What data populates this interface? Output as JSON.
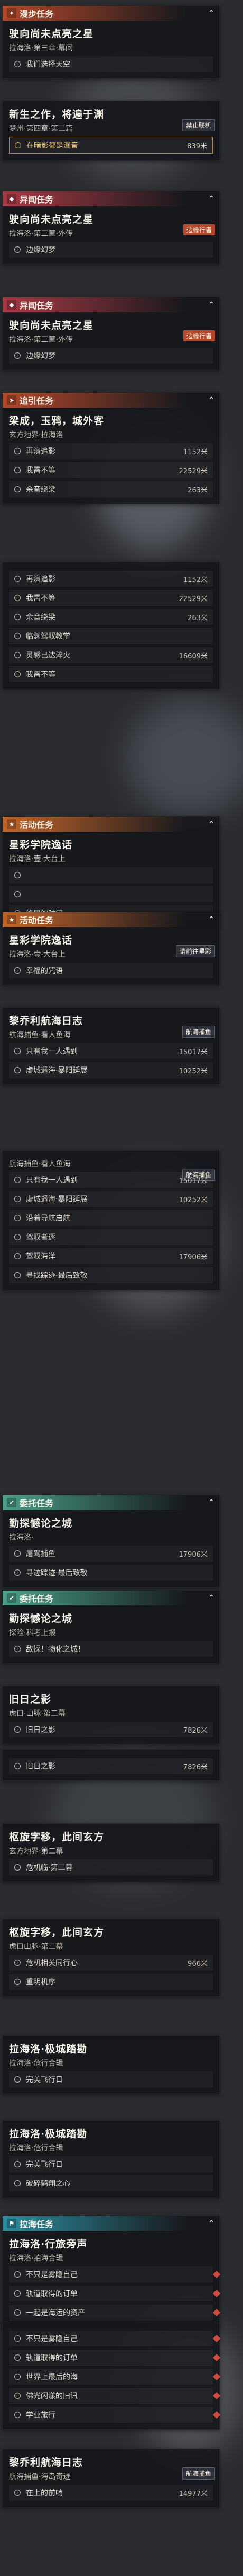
{
  "colors": {
    "story": "#b4482a",
    "anomaly": "#a83a44",
    "event": "#c4662a",
    "errand": "#4aa08a",
    "world": "#2c8fa0"
  },
  "cards": [
    {
      "cat": "漫步任务",
      "title": "驶向尚未点亮之星",
      "sub": "拉海洛·第三章·幕间",
      "rows": [
        {
          "t": "我们选择天空",
          "d": ""
        }
      ],
      "badge": "",
      "icon": "play-icon"
    },
    {
      "cat": "",
      "title": "新生之作，将遍于渊",
      "sub": "梦州·第四章·第二篇",
      "rows": [
        {
          "t": "在暗影都是漏音",
          "d": "839米",
          "gold": true
        }
      ],
      "badge": "禁止联机",
      "icon": ""
    },
    {
      "cat": "异闻任务",
      "title": "驶向尚未点亮之星",
      "sub": "拉海洛·第三章·外传",
      "rows": [
        {
          "t": "边缘幻梦",
          "d": ""
        }
      ],
      "badge": "边缘行者",
      "icon": "diamond-icon"
    },
    {
      "cat": "异闻任务",
      "title": "驶向尚未点亮之星",
      "sub": "拉海洛·第三章·外传",
      "rows": [
        {
          "t": "边缘幻梦",
          "d": ""
        }
      ],
      "badge": "边缘行者",
      "icon": "diamond-icon"
    },
    {
      "cat": "追引任务",
      "title": "梁成，玉鸦，城外客",
      "sub": "玄方地界·拉海洛",
      "rows": [
        {
          "t": "再演追影",
          "d": "1152米"
        },
        {
          "t": "我需不等",
          "d": "22529米"
        },
        {
          "t": "余音绕梁",
          "d": "263米"
        }
      ],
      "badge": "",
      "icon": "arrow-icon"
    },
    {
      "cat": "",
      "title": "",
      "sub": "",
      "rows": [
        {
          "t": "再演追影",
          "d": "1152米"
        },
        {
          "t": "我需不等",
          "d": "22529米"
        },
        {
          "t": "余音绕梁",
          "d": "263米"
        },
        {
          "t": "临渊驾驭教学",
          "d": ""
        },
        {
          "t": "灵感已达淬火",
          "d": "16609米"
        },
        {
          "t": "我需不等",
          "d": ""
        }
      ],
      "badge": "",
      "icon": ""
    },
    {
      "cat": "活动任务",
      "title": "星彩学院逸话",
      "sub": "拉海洛·壹·大台上",
      "rows": [
        {
          "t": "",
          "d": ""
        },
        {
          "t": "",
          "d": ""
        },
        {
          "t": "终局的时间",
          "d": ""
        }
      ],
      "badge": "",
      "icon": "star-icon"
    },
    {
      "cat": "活动任务",
      "title": "星彩学院逸话",
      "sub": "拉海洛·壹·大台上",
      "rows": [
        {
          "t": "幸福的咒语",
          "d": ""
        }
      ],
      "badge": "请前往星彩",
      "icon": "star-icon"
    },
    {
      "cat": "",
      "title": "黎乔利航海日志",
      "sub": "航海捕鱼·看人鱼海",
      "rows": [
        {
          "t": "只有我一人遇到",
          "d": "15017米"
        },
        {
          "t": "虚城遥海·暴阳延展",
          "d": "10252米"
        }
      ],
      "badge": "航海捕鱼",
      "icon": ""
    },
    {
      "cat": "",
      "title": "",
      "sub": "航海捕鱼·看人鱼海",
      "rows": [
        {
          "t": "只有我一人遇到",
          "d": "15017米"
        },
        {
          "t": "虚城遥海·暴阳延展",
          "d": "10252米"
        },
        {
          "t": "沿着导航启航",
          "d": ""
        },
        {
          "t": "驾驭者逐",
          "d": ""
        },
        {
          "t": "驾驭海洋",
          "d": "17906米"
        },
        {
          "t": "寻找踪迹·最后致敬",
          "d": ""
        }
      ],
      "badge": "航海捕鱼",
      "icon": ""
    },
    {
      "cat": "委托任务",
      "title": "勤探憾论之城",
      "sub": "拉海洛·",
      "rows": [
        {
          "t": "屠驾捕鱼",
          "d": "17906米"
        },
        {
          "t": "寻迹踪迹·最后致敬",
          "d": ""
        }
      ],
      "badge": "",
      "icon": "check-icon"
    },
    {
      "cat": "委托任务",
      "title": "勤探憾论之城",
      "sub": "探险·科考上报",
      "rows": [
        {
          "t": "敌探！物化之城！",
          "d": ""
        }
      ],
      "badge": "",
      "icon": "check-icon"
    },
    {
      "cat": "",
      "title": "旧日之影",
      "sub": "虎口·山脉·第二幕",
      "rows": [
        {
          "t": "旧日之影",
          "d": "7826米"
        }
      ],
      "badge": "",
      "icon": ""
    },
    {
      "cat": "",
      "title": "",
      "sub": "",
      "rows": [
        {
          "t": "旧日之影",
          "d": "7826米"
        }
      ],
      "badge": "",
      "icon": ""
    },
    {
      "cat": "",
      "title": "枢旋字移，此间玄方",
      "sub": "玄方地界·第二幕",
      "rows": [
        {
          "t": "危机临·第二幕",
          "d": ""
        }
      ],
      "badge": "",
      "icon": ""
    },
    {
      "cat": "",
      "title": "枢旋字移，此间玄方",
      "sub": "虎口山脉·第二幕",
      "rows": [
        {
          "t": "危机相关同行心",
          "d": "966米"
        },
        {
          "t": "重明机序",
          "d": ""
        }
      ],
      "badge": "",
      "icon": ""
    },
    {
      "cat": "",
      "title": "拉海洛·极城踏勘",
      "sub": "拉海洛·危行合辑",
      "rows": [
        {
          "t": "完美飞行日",
          "d": ""
        }
      ],
      "badge": "",
      "icon": ""
    },
    {
      "cat": "",
      "title": "拉海洛·极城踏勘",
      "sub": "拉海洛·危行合辑",
      "rows": [
        {
          "t": "完美飞行日",
          "d": ""
        },
        {
          "t": "破碎鹤翔之心",
          "d": ""
        }
      ],
      "badge": "",
      "icon": ""
    },
    {
      "cat": "拉海任务",
      "title": "拉海洛·行旅旁声",
      "sub": "拉海洛·拍海合辑",
      "rows": [
        {
          "t": "不只是雾隐自己",
          "d": ""
        },
        {
          "t": "轨道取得的订单",
          "d": ""
        },
        {
          "t": "一起是海运的资产",
          "d": ""
        }
      ],
      "badge": "",
      "icon": "pin-icon"
    },
    {
      "cat": "",
      "title": "",
      "sub": "",
      "rows": [
        {
          "t": "不只是雾隐自己",
          "d": ""
        },
        {
          "t": "轨道取得的订单",
          "d": ""
        },
        {
          "t": "世界上最后的海",
          "d": ""
        },
        {
          "t": "佛光闪漾的旧讯",
          "d": ""
        },
        {
          "t": "学业旅行",
          "d": ""
        }
      ],
      "badge": "",
      "icon": ""
    },
    {
      "cat": "",
      "title": "黎乔利航海日志",
      "sub": "航海捕鱼·海岛奇迹",
      "rows": [
        {
          "t": "在上的前哨",
          "d": "14977米"
        }
      ],
      "badge": "航海捕鱼",
      "icon": ""
    }
  ]
}
